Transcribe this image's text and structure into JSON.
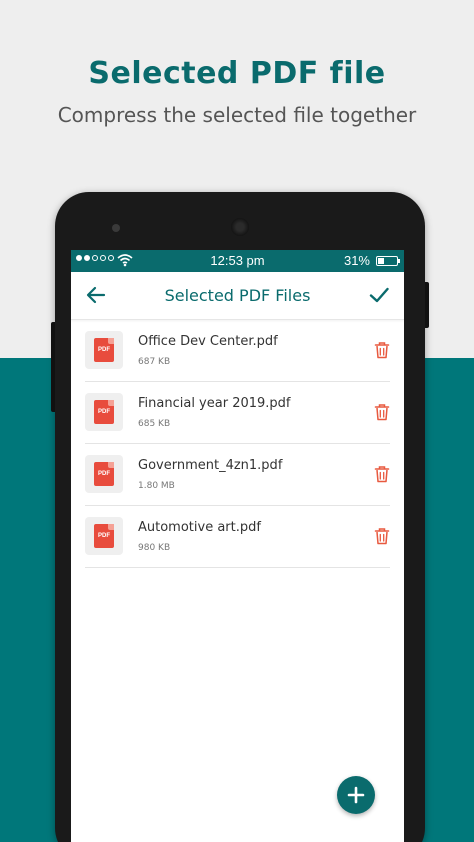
{
  "promo": {
    "headline": "Selected PDF file",
    "subhead": "Compress the selected file together"
  },
  "status_bar": {
    "signal_dots_filled": 2,
    "signal_dots_total": 5,
    "time": "12:53 pm",
    "battery_label": "31%",
    "battery_level": 0.31
  },
  "app_bar": {
    "title": "Selected PDF Files",
    "back_icon": "arrow-left-icon",
    "confirm_icon": "check-icon"
  },
  "files": [
    {
      "name": "Office Dev Center.pdf",
      "size": "687 KB",
      "badge": "PDF"
    },
    {
      "name": "Financial year 2019.pdf",
      "size": "685 KB",
      "badge": "PDF"
    },
    {
      "name": "Government_4zn1.pdf",
      "size": "1.80 MB",
      "badge": "PDF"
    },
    {
      "name": "Automotive art.pdf",
      "size": "980 KB",
      "badge": "PDF"
    }
  ],
  "fab": {
    "icon": "plus-icon"
  },
  "colors": {
    "brand": "#0a6b6d",
    "lower_background": "#00777a",
    "pdf_red": "#e84c3d",
    "trash_red": "#e8593f"
  }
}
